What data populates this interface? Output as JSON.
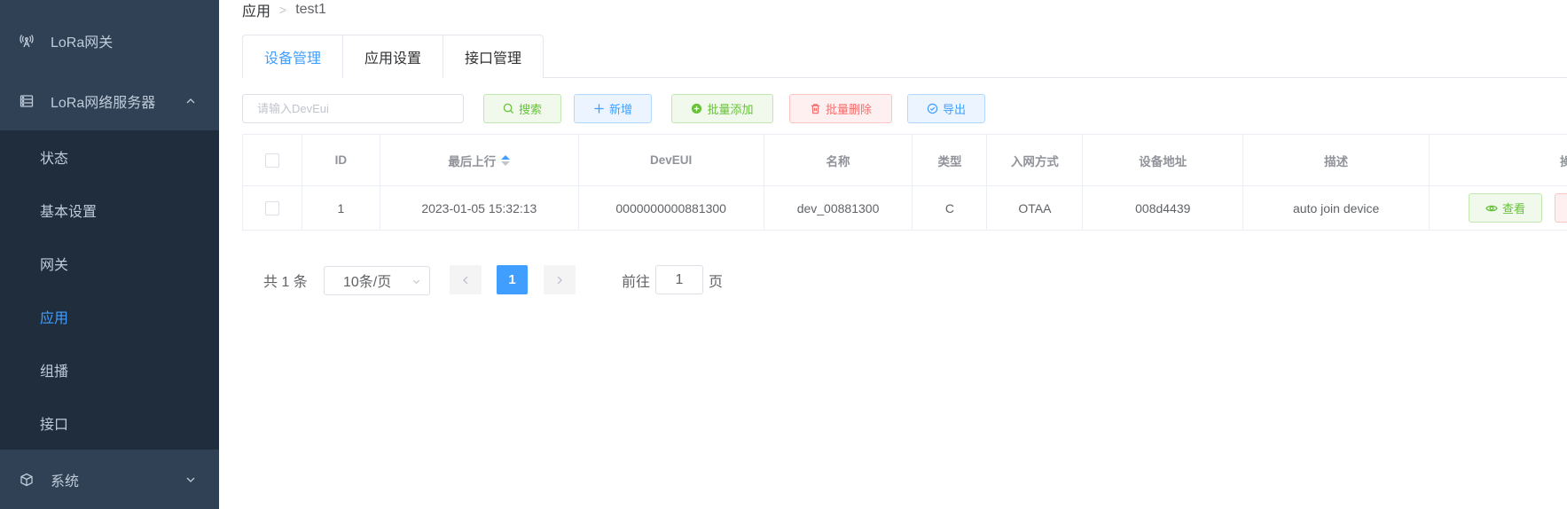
{
  "sidebar": {
    "gateway_label": "LoRa网关",
    "server_label": "LoRa网络服务器",
    "sub_items": [
      "状态",
      "基本设置",
      "网关",
      "应用",
      "组播",
      "接口"
    ],
    "active_sub": "应用",
    "system_label": "系统"
  },
  "breadcrumb": {
    "root": "应用",
    "current": "test1"
  },
  "tabs": [
    "设备管理",
    "应用设置",
    "接口管理"
  ],
  "active_tab": "设备管理",
  "toolbar": {
    "search_placeholder": "请输入DevEui",
    "search_label": "搜索",
    "add_label": "新增",
    "batch_add_label": "批量添加",
    "batch_delete_label": "批量删除",
    "export_label": "导出"
  },
  "table": {
    "headers": {
      "id": "ID",
      "last_uplink": "最后上行",
      "deveui": "DevEUI",
      "name": "名称",
      "type": "类型",
      "join_method": "入网方式",
      "address": "设备地址",
      "description": "描述",
      "actions": "操作"
    },
    "rows": [
      {
        "id": "1",
        "last_uplink": "2023-01-05 15:32:13",
        "deveui": "0000000000881300",
        "name": "dev_00881300",
        "type": "C",
        "join_method": "OTAA",
        "address": "008d4439",
        "description": "auto join device",
        "view_label": "查看"
      }
    ]
  },
  "pagination": {
    "total_text": "共 1 条",
    "page_size": "10条/页",
    "current_page": "1",
    "goto_label": "前往",
    "goto_value": "1",
    "goto_unit": "页"
  },
  "colors": {
    "sidebar_bg": "#304156",
    "submenu_bg": "#1f2d3d",
    "accent": "#409eff"
  }
}
